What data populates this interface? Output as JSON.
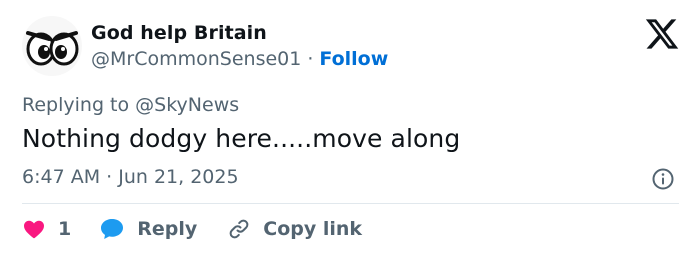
{
  "user": {
    "display_name": "God help Britain",
    "handle": "@MrCommonSense01",
    "separator": "·",
    "follow_label": "Follow",
    "avatar_icon": "cartoon-eyes-icon"
  },
  "reply_context": {
    "prefix": "Replying to",
    "mention": "@SkyNews"
  },
  "tweet": {
    "text": "Nothing dodgy here.....move along",
    "timestamp": "6:47 AM · Jun 21, 2025"
  },
  "actions": {
    "like_count": "1",
    "reply_label": "Reply",
    "copy_label": "Copy link"
  },
  "icons": {
    "brand": "x-logo-icon",
    "info": "info-icon",
    "like": "heart-icon",
    "reply": "speech-bubble-icon",
    "copy": "link-icon"
  },
  "colors": {
    "text": "#0f1419",
    "muted": "#536471",
    "follow": "#006fd6",
    "heart": "#f91880",
    "reply_bubble": "#1d9bf0",
    "divider": "#e1e8ed"
  }
}
